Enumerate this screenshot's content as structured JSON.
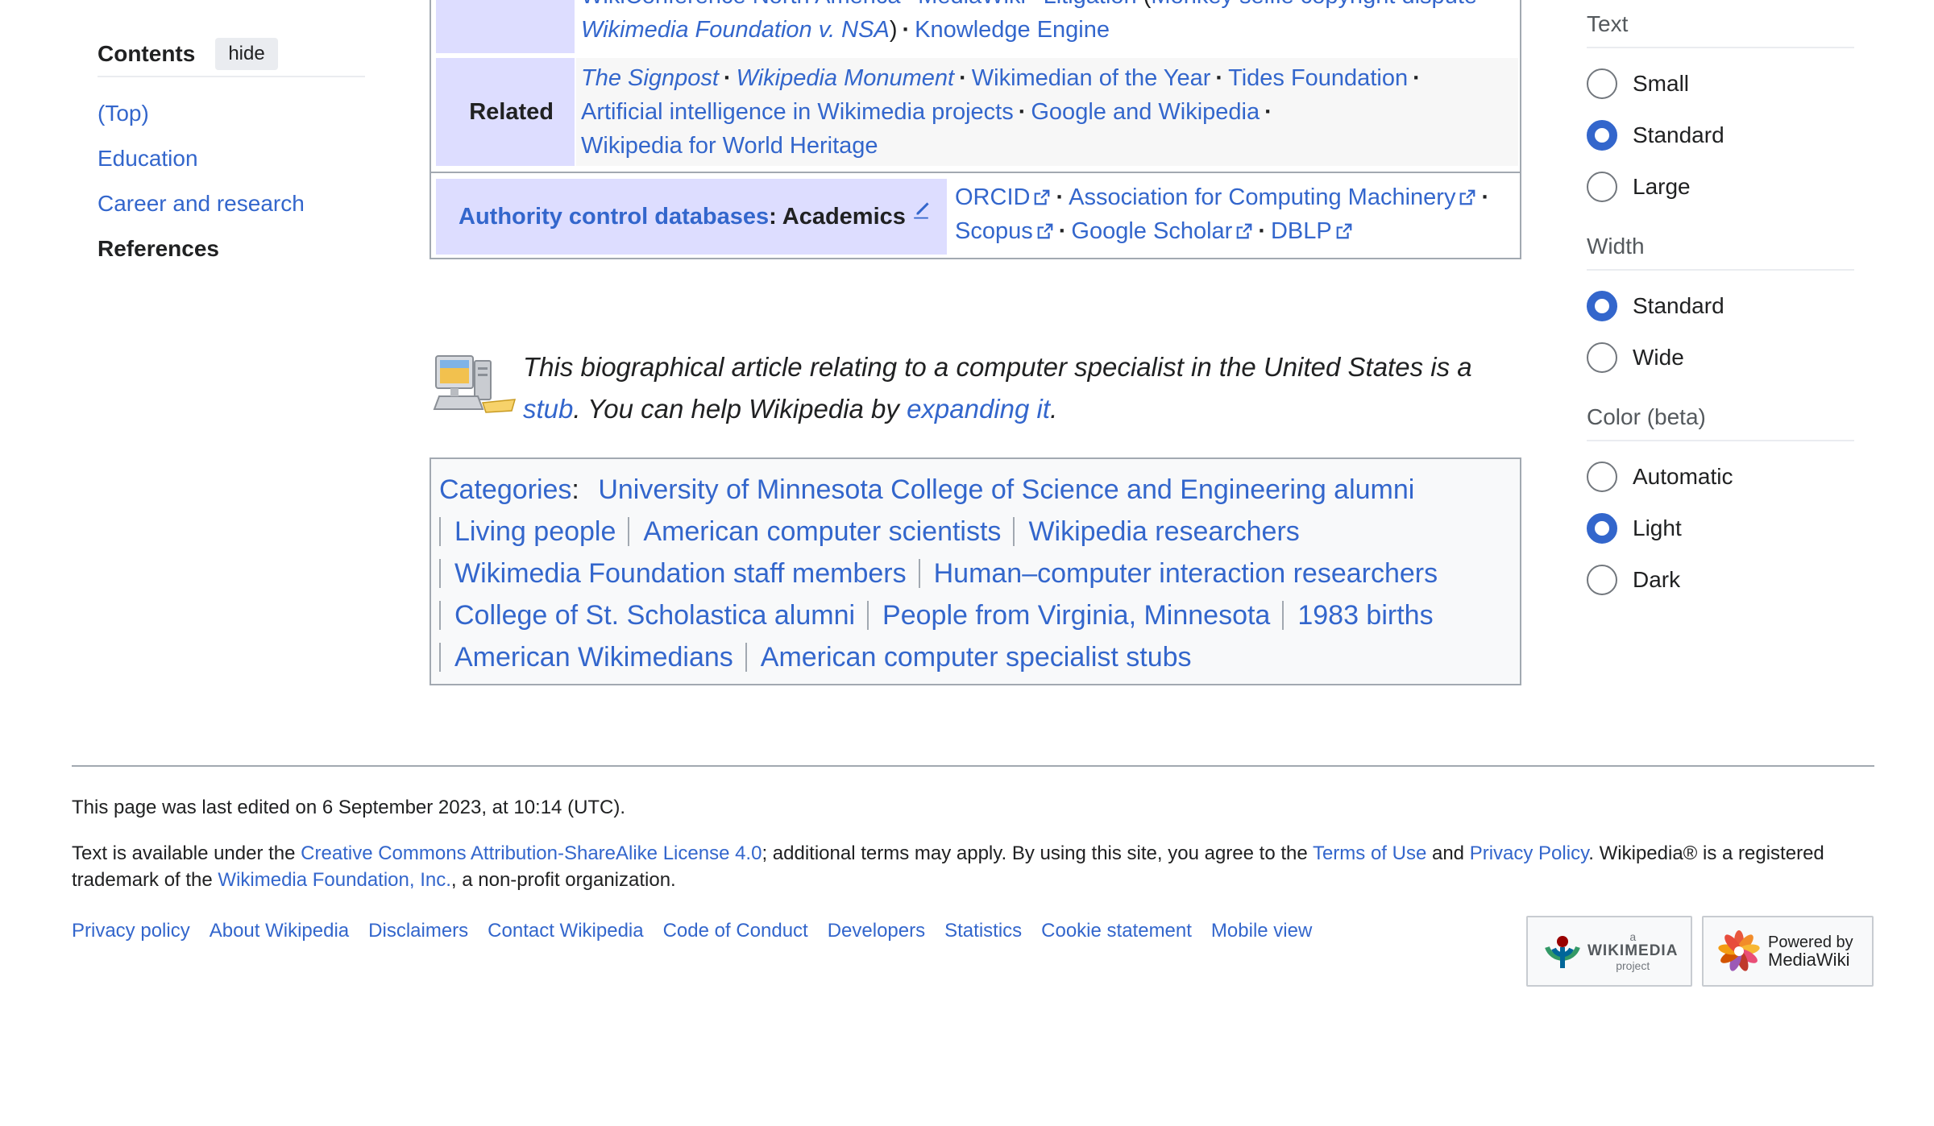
{
  "toc": {
    "title": "Contents",
    "hide_label": "hide",
    "items": [
      "(Top)",
      "Education",
      "Career and research",
      "References"
    ]
  },
  "navbox": {
    "row0": {
      "item1": "WikiConference North America",
      "item2": "MediaWiki",
      "item3": "Litigation",
      "item3b": "Monkey selfie copyright dispute",
      "item4": "Wikimedia Foundation v. NSA",
      "item5": "Knowledge Engine"
    },
    "related": {
      "label": "Related",
      "items": [
        "The Signpost",
        "Wikipedia Monument",
        "Wikimedian of the Year",
        "Tides Foundation",
        "Artificial intelligence in Wikimedia projects",
        "Google and Wikipedia",
        "Wikipedia for World Heritage"
      ]
    },
    "authority": {
      "label_link": "Authority control databases",
      "label_rest": ": Academics",
      "items": [
        "ORCID",
        "Association for Computing Machinery",
        "Scopus",
        "Google Scholar",
        "DBLP"
      ]
    }
  },
  "stub": {
    "text1": "This biographical article relating to a computer specialist in the United States is a ",
    "link1": "stub",
    "text2": ". You can help Wikipedia by ",
    "link2": "expanding it",
    "text3": "."
  },
  "categories": {
    "label": "Categories",
    "items": [
      "University of Minnesota College of Science and Engineering alumni",
      "Living people",
      "American computer scientists",
      "Wikipedia researchers",
      "Wikimedia Foundation staff members",
      "Human–computer interaction researchers",
      "College of St. Scholastica alumni",
      "People from Virginia, Minnesota",
      "1983 births",
      "American Wikimedians",
      "American computer specialist stubs"
    ]
  },
  "appearance": {
    "text": {
      "title": "Text",
      "options": [
        "Small",
        "Standard",
        "Large"
      ],
      "selected": "Standard"
    },
    "width": {
      "title": "Width",
      "options": [
        "Standard",
        "Wide"
      ],
      "selected": "Standard"
    },
    "color": {
      "title": "Color (beta)",
      "options": [
        "Automatic",
        "Light",
        "Dark"
      ],
      "selected": "Light"
    }
  },
  "footer": {
    "last_edited": "This page was last edited on 6 September 2023, at 10:14 (UTC).",
    "license_pre": "Text is available under the ",
    "license_link": "Creative Commons Attribution-ShareAlike License 4.0",
    "license_mid": "; additional terms may apply. By using this site, you agree to the ",
    "terms_link": "Terms of Use",
    "and": " and ",
    "privacy_link": "Privacy Policy",
    "license_post": ". Wikipedia® is a registered trademark of the ",
    "wmf_link": "Wikimedia Foundation, Inc.",
    "license_end": ", a non-profit organization.",
    "places": [
      "Privacy policy",
      "About Wikipedia",
      "Disclaimers",
      "Contact Wikipedia",
      "Code of Conduct",
      "Developers",
      "Statistics",
      "Cookie statement",
      "Mobile view"
    ],
    "badge_wikimedia": {
      "small": "a",
      "name": "WIKIMEDIA",
      "sub": "project"
    },
    "badge_mediawiki": {
      "line1": "Powered by",
      "line2": "MediaWiki"
    }
  },
  "colors": {
    "link": "#3366cc",
    "navbox_group": "#ddddff",
    "border": "#a2a9b1",
    "radio_checked": "#3366cc"
  }
}
